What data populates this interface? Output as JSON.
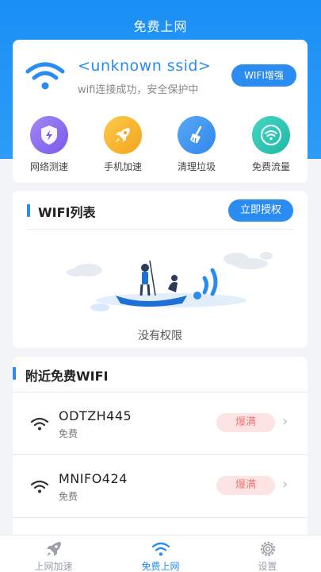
{
  "header": {
    "title": "免费上网"
  },
  "status": {
    "ssid": "<unknown ssid>",
    "connection_text": "wifi连接成功，安全保护中",
    "boost_label": "WIFI增强"
  },
  "tools": [
    {
      "label": "网络测速",
      "icon": "shield-bolt-icon",
      "color": "#8b6cf0"
    },
    {
      "label": "手机加速",
      "icon": "rocket-icon",
      "color": "#f5b22c"
    },
    {
      "label": "清理垃圾",
      "icon": "broom-icon",
      "color": "#3e95f0"
    },
    {
      "label": "免费流量",
      "icon": "wifi-icon",
      "color": "#2cc7b5"
    }
  ],
  "wifi_list": {
    "title": "WIFI列表",
    "authorize_label": "立即授权",
    "empty_text": "没有权限"
  },
  "nearby": {
    "title": "附近免费WIFI",
    "networks": [
      {
        "name": "ODTZH445",
        "subtitle": "免费",
        "badge": "爆满"
      },
      {
        "name": "MNIFO424",
        "subtitle": "免费",
        "badge": "爆满"
      }
    ]
  },
  "bottom_nav": {
    "items": [
      {
        "label": "上网加速",
        "icon": "rocket-icon",
        "active": false
      },
      {
        "label": "免费上网",
        "icon": "wifi-icon",
        "active": true
      },
      {
        "label": "设置",
        "icon": "gear-icon",
        "active": false
      }
    ]
  },
  "colors": {
    "primary": "#2a8cf0",
    "badge_bg": "#fde4e4",
    "badge_text": "#ef7b7b"
  }
}
